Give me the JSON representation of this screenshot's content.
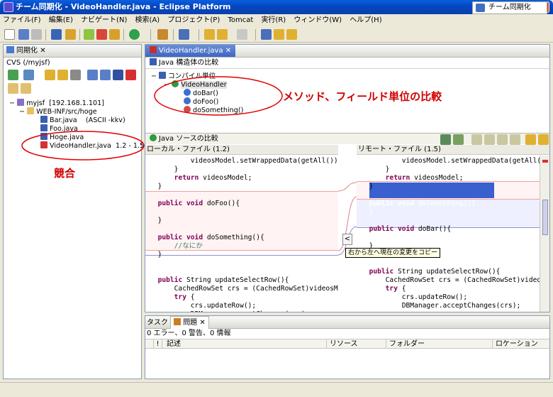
{
  "window": {
    "title": "チーム同期化 - VideoHandler.java - Eclipse Platform"
  },
  "menu": [
    "ファイル(F)",
    "編集(E)",
    "ナビゲート(N)",
    "検索(A)",
    "プロジェクト(P)",
    "Tomcat",
    "実行(R)",
    "ウィンドウ(W)",
    "ヘルプ(H)"
  ],
  "perspective": {
    "label": "チーム同期化"
  },
  "sync_view": {
    "tab": "同期化",
    "repo": "CVS (/myjsf)",
    "tree": {
      "project": "myjsf",
      "project_host": "[192.168.1.101]",
      "folder": "WEB-INF/src/hoge",
      "files": [
        {
          "name": "Bar.java",
          "detail": "(ASCII -kkv)"
        },
        {
          "name": "Foo.java",
          "detail": ""
        },
        {
          "name": "Hoge.java",
          "detail": ""
        },
        {
          "name": "VideoHandler.java",
          "detail": "1.2 - 1.5"
        }
      ]
    },
    "annotation_conflict": "競合"
  },
  "editor": {
    "tab": "VideoHandler.java",
    "structure_title": "Java 構造体の比較",
    "structure": {
      "root": "コンパイル単位",
      "class": "VideoHandler",
      "methods": [
        "doBar()",
        "doFoo()",
        "doSomething()"
      ]
    },
    "annotation_method": "メソッド、フィールド単位の比較",
    "source_title": "Java ソースの比較",
    "left_title": "ローカル・ファイル (1.2)",
    "right_title": "リモート・ファイル (1.5)",
    "tooltip": "右から左へ現在の変更をコピー"
  },
  "problems": {
    "tab_task": "タスク",
    "tab_problems": "問題",
    "summary": "0 エラー、0 警告、0 情報",
    "columns": [
      "",
      "!",
      "記述",
      "リソース",
      "フォルダー",
      "ロケーション"
    ]
  }
}
